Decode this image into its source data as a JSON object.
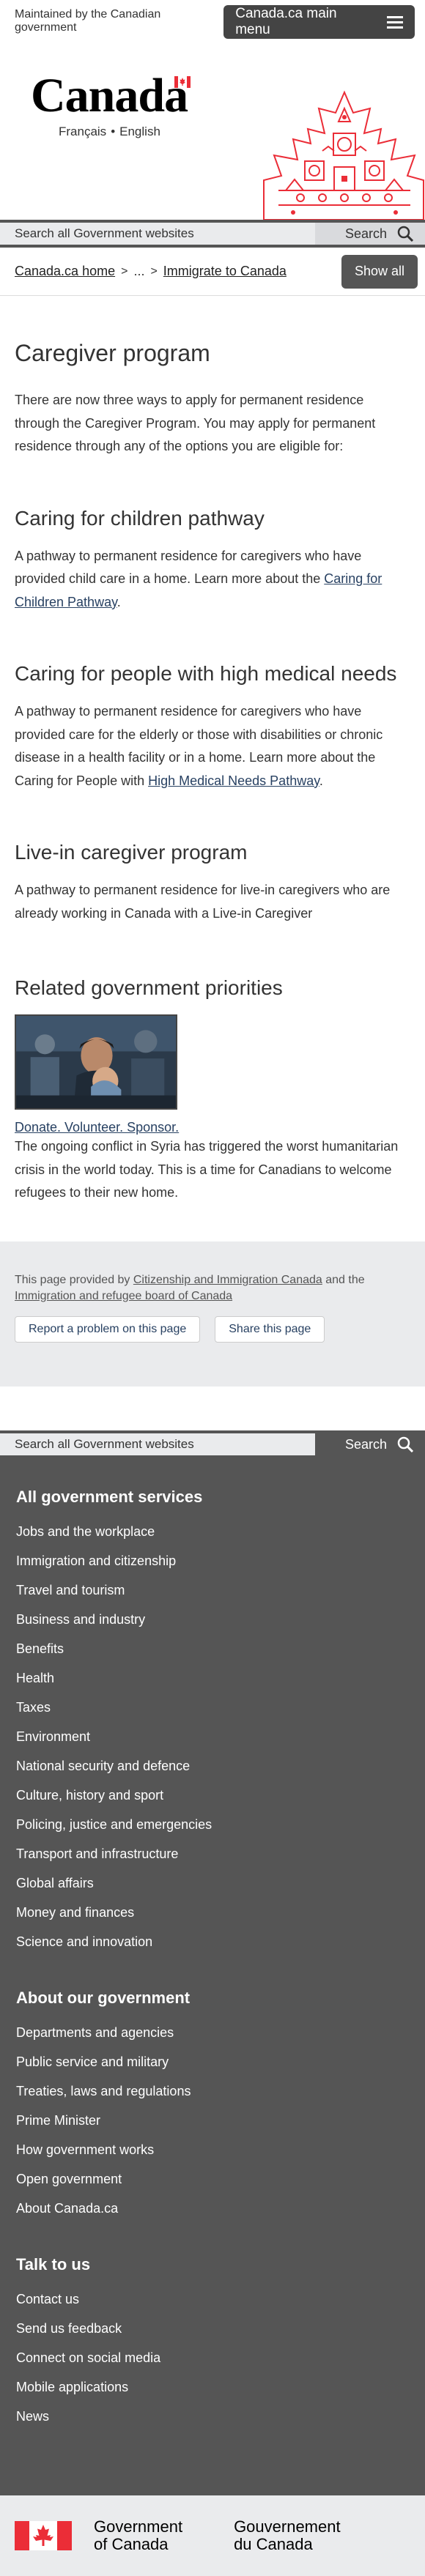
{
  "top_bar": {
    "maintained": "Maintained by the Canadian government",
    "menu_label": "Canada.ca main menu"
  },
  "brand": {
    "wordmark": "Canada",
    "lang_fr": "Français",
    "lang_sep": "•",
    "lang_en": "English"
  },
  "search": {
    "placeholder": "Search all Government websites",
    "button": "Search"
  },
  "breadcrumb": {
    "home": "Canada.ca home",
    "sep1": ">",
    "ellipsis": "...",
    "sep2": ">",
    "current": "Immigrate to Canada",
    "show_all": "Show all"
  },
  "main": {
    "title": "Caregiver program",
    "intro": "There are now three ways to apply for permanent residence through the Caregiver Program.  You may apply for permanent residence through any of the options you are eligible for:",
    "sections": [
      {
        "heading": "Caring for children pathway",
        "text": "A pathway to permanent residence for caregivers who have provided child care in a home. Learn more about the ",
        "link": "Caring for Children Pathway",
        "after": "."
      },
      {
        "heading": "Caring for people with high medical needs",
        "text": "A pathway to permanent residence for caregivers who have provided care for the elderly or those with disabilities or chronic disease in a health facility or in a home. Learn more about the Caring for People with ",
        "link": "High Medical Needs Pathway",
        "after": "."
      },
      {
        "heading": "Live-in caregiver program",
        "text": "A pathway to permanent residence for live-in caregivers who are already working in Canada with a Live-in Caregiver"
      }
    ],
    "related": {
      "heading": "Related government priorities",
      "link": "Donate. Volunteer. Sponsor.",
      "description": "The ongoing conflict in Syria has triggered the worst humanitarian crisis in the world today.  This is a time for Canadians to welcome refugees to their new home."
    }
  },
  "page_details": {
    "prefix": "This page provided by ",
    "link1": "Citizenship and Immigration Canada",
    "middle": " and the ",
    "link2": "Immigration and refugee board of Canada",
    "report": "Report a problem on this page",
    "share": "Share this page"
  },
  "footer": {
    "services_heading": "All government services",
    "services": [
      "Jobs and the workplace",
      "Immigration and citizenship",
      "Travel and tourism",
      "Business and industry",
      "Benefits",
      "Health",
      "Taxes",
      "Environment",
      "National security and defence",
      "Culture, history and sport",
      "Policing, justice and emergencies",
      "Transport and infrastructure",
      "Global affairs",
      "Money and finances",
      "Science and innovation"
    ],
    "about_heading": "About our government",
    "about": [
      "Departments and agencies",
      "Public service and military",
      "Treaties, laws and regulations",
      "Prime Minister",
      "How government works",
      "Open government",
      "About Canada.ca"
    ],
    "talk_heading": "Talk to us",
    "talk": [
      "Contact us",
      "Send us feedback",
      "Connect on social media",
      "Mobile applications",
      "News"
    ],
    "signature_en_1": "Government",
    "signature_en_2": "of Canada",
    "signature_fr_1": "Gouvernement",
    "signature_fr_2": "du Canada"
  },
  "colors": {
    "flag_red": "#eb2d37",
    "link": "#284162",
    "footer_bg": "#555555",
    "light_bg": "#eaebed"
  }
}
